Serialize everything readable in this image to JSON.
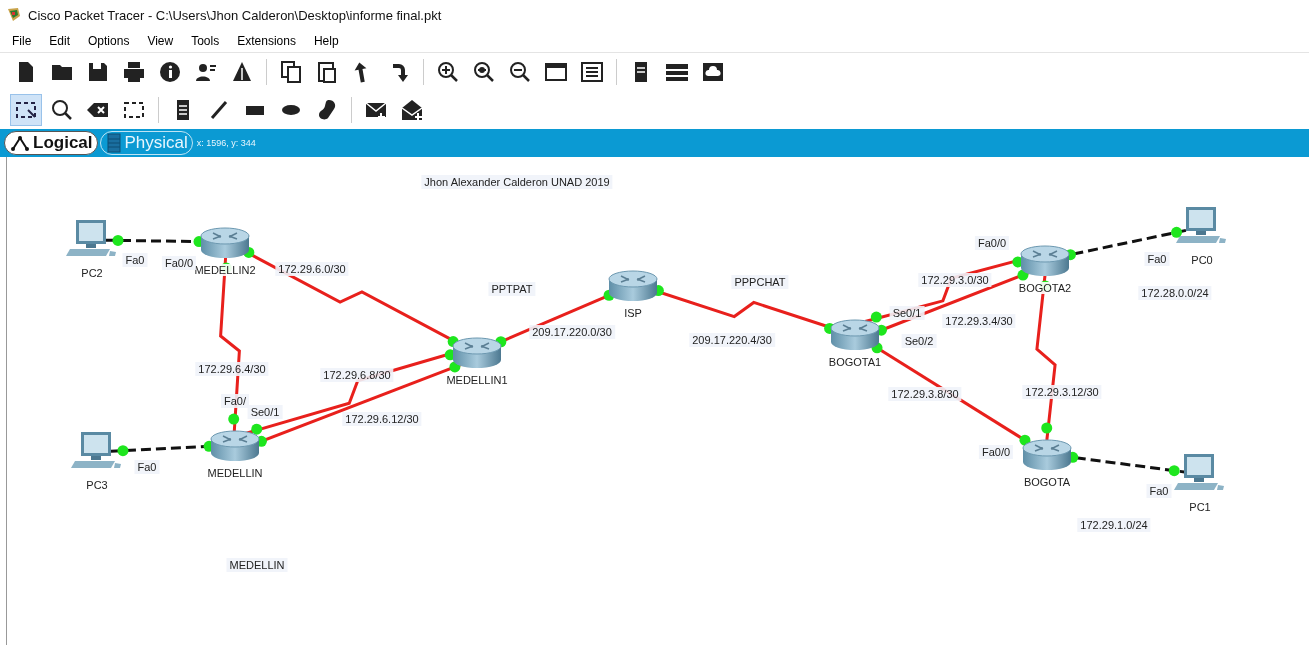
{
  "window": {
    "title": "Cisco Packet Tracer - C:\\Users\\Jhon Calderon\\Desktop\\informe final.pkt"
  },
  "menu": [
    "File",
    "Edit",
    "Options",
    "View",
    "Tools",
    "Extensions",
    "Help"
  ],
  "toolbar": {
    "main": [
      {
        "kind": "new"
      },
      {
        "kind": "open"
      },
      {
        "kind": "save"
      },
      {
        "kind": "print"
      },
      {
        "kind": "info"
      },
      {
        "kind": "wizard"
      },
      {
        "kind": "network"
      },
      {
        "kind": "sep"
      },
      {
        "kind": "copy"
      },
      {
        "kind": "paste"
      },
      {
        "kind": "undo"
      },
      {
        "kind": "redo"
      },
      {
        "kind": "sep"
      },
      {
        "kind": "zoom-in"
      },
      {
        "kind": "zoom-reset"
      },
      {
        "kind": "zoom-out"
      },
      {
        "kind": "window"
      },
      {
        "kind": "list"
      },
      {
        "kind": "sep"
      },
      {
        "kind": "server"
      },
      {
        "kind": "rack"
      },
      {
        "kind": "cloud"
      }
    ],
    "tools": [
      {
        "kind": "select",
        "selected": true
      },
      {
        "kind": "inspect",
        "selected": false
      },
      {
        "kind": "delete",
        "selected": false
      },
      {
        "kind": "resize",
        "selected": false
      },
      {
        "kind": "sep"
      },
      {
        "kind": "note",
        "selected": false
      },
      {
        "kind": "line",
        "selected": false
      },
      {
        "kind": "rect",
        "selected": false
      },
      {
        "kind": "ellipse",
        "selected": false
      },
      {
        "kind": "freeform",
        "selected": false
      },
      {
        "kind": "sep"
      },
      {
        "kind": "pdu",
        "selected": false
      },
      {
        "kind": "complex-pdu",
        "selected": false
      }
    ]
  },
  "tabs": [
    {
      "label": "Logical",
      "selected": true
    },
    {
      "label": "Physical",
      "selected": false
    }
  ],
  "coordinates": "x: 1596, y: 344",
  "devices": [
    {
      "name": "PC2",
      "kind": "pc"
    },
    {
      "name": "MEDELLIN2",
      "kind": "router"
    },
    {
      "name": "PC3",
      "kind": "pc"
    },
    {
      "name": "MEDELLIN",
      "kind": "router"
    },
    {
      "name": "MEDELLIN1",
      "kind": "router"
    },
    {
      "name": "ISP",
      "kind": "router"
    },
    {
      "name": "BOGOTA1",
      "kind": "router"
    },
    {
      "name": "BOGOTA2",
      "kind": "router"
    },
    {
      "name": "PC0",
      "kind": "pc"
    },
    {
      "name": "BOGOTA",
      "kind": "router"
    },
    {
      "name": "PC1",
      "kind": "pc"
    }
  ],
  "links": [
    {
      "kind": "ethernet",
      "up": true
    },
    {
      "kind": "serial",
      "up": true
    },
    {
      "kind": "serial",
      "up": true
    },
    {
      "kind": "ethernet",
      "up": true
    },
    {
      "kind": "serial",
      "up": true
    },
    {
      "kind": "direct",
      "up": true
    },
    {
      "kind": "direct",
      "up": true
    },
    {
      "kind": "serial",
      "up": true
    },
    {
      "kind": "serial",
      "up": true
    },
    {
      "kind": "direct",
      "up": true
    },
    {
      "kind": "direct",
      "up": true
    },
    {
      "kind": "serial",
      "up": true
    },
    {
      "kind": "ethernet",
      "up": true
    },
    {
      "kind": "ethernet",
      "up": true
    }
  ],
  "notes": [
    "Jhon Alexander Calderon UNAD 2019",
    "PPTPAT",
    "PPPCHAT",
    "MEDELLIN"
  ],
  "networks": [
    "172.29.6.0/30",
    "172.29.6.4/30",
    "172.29.6.8/30",
    "172.29.6.12/30",
    "209.17.220.0/30",
    "209.17.220.4/30",
    "172.29.3.0/30",
    "172.29.3.4/30",
    "172.29.3.8/30",
    "172.29.3.12/30",
    "172.28.0.0/24",
    "172.29.1.0/24"
  ],
  "ports": [
    "Fa0",
    "Fa0/0",
    "Fa0/",
    "Se0/1",
    "Fa0",
    "Se0/1",
    "Se0/2",
    "Fa0/0",
    "Fa0",
    "Fa0",
    "Fa0/0"
  ]
}
